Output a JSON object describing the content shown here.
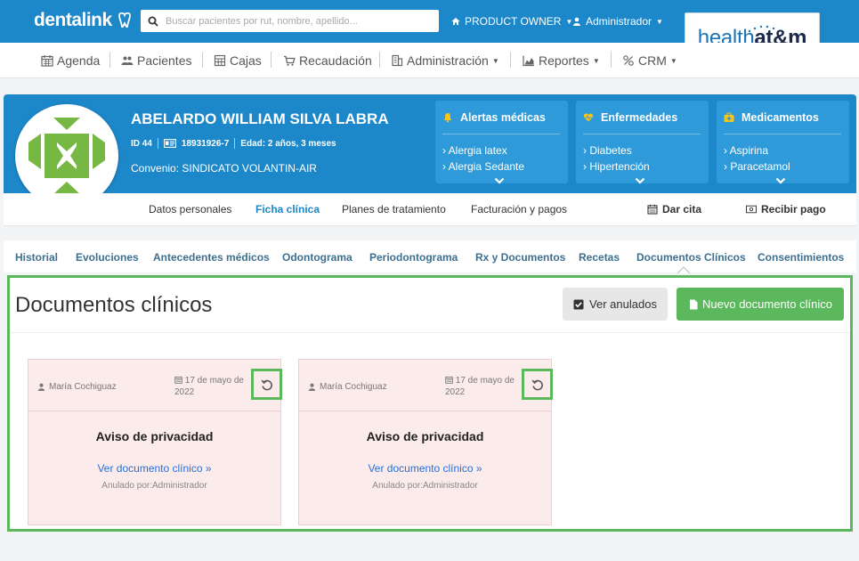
{
  "topbar": {
    "logo_text": "dentalink",
    "search_placeholder": "Buscar pacientes por rut, nombre, apellido...",
    "role_menu": "PRODUCT OWNER",
    "user_menu": "Administrador",
    "partner_logo_a": "health",
    "partner_logo_b": "at",
    "partner_logo_c": "m"
  },
  "nav": {
    "items": [
      {
        "label": "Agenda",
        "icon": "calendar-icon"
      },
      {
        "label": "Pacientes",
        "icon": "users-icon"
      },
      {
        "label": "Cajas",
        "icon": "calculator-icon"
      },
      {
        "label": "Recaudación",
        "icon": "cart-icon"
      },
      {
        "label": "Administración",
        "icon": "building-icon"
      },
      {
        "label": "Reportes",
        "icon": "chart-icon"
      },
      {
        "label": "CRM",
        "icon": "percent-icon"
      }
    ]
  },
  "patient": {
    "name": "ABELARDO WILLIAM SILVA LABRA",
    "id": "ID 44",
    "rut": "18931926-7",
    "age": "Edad: 2 años, 3 meses",
    "convenio": "Convenio: SINDICATO VOLANTIN-AIR"
  },
  "info_boxes": [
    {
      "title": "Alertas médicas",
      "icon": "bell-icon",
      "items": [
        "Alergia latex",
        "Alergia Sedante"
      ]
    },
    {
      "title": "Enfermedades",
      "icon": "heart-icon",
      "items": [
        "Diabetes",
        "Hipertención"
      ]
    },
    {
      "title": "Medicamentos",
      "icon": "medkit-icon",
      "items": [
        "Aspirina",
        "Paracetamol"
      ]
    }
  ],
  "patient_tabs": {
    "datos": "Datos personales",
    "ficha": "Ficha clínica",
    "planes": "Planes de tratamiento",
    "facturacion": "Facturación y pagos",
    "dar_cita": "Dar cita",
    "recibir_pago": "Recibir pago"
  },
  "clinical_tabs": [
    "Historial",
    "Evoluciones",
    "Antecedentes médicos",
    "Odontograma",
    "Periodontograma",
    "Rx y Documentos",
    "Recetas",
    "Documentos Clínicos",
    "Consentimientos"
  ],
  "main": {
    "title": "Documentos clínicos",
    "ver_anulados": "Ver anulados",
    "nuevo_documento": "Nuevo documento clínico"
  },
  "cards": [
    {
      "author": "María Cochiguaz",
      "date": "17 de mayo de 2022",
      "title": "Aviso de privacidad",
      "link": "Ver documento clínico  »",
      "anulado": "Anulado por:Administrador"
    },
    {
      "author": "María Cochiguaz",
      "date": "17 de mayo de 2022",
      "title": "Aviso de privacidad",
      "link": "Ver documento clínico  »",
      "anulado": "Anulado por:Administrador"
    }
  ],
  "colors": {
    "primary": "#1c87c9",
    "success": "#5cb85c",
    "card_bg": "#fcebeb"
  }
}
